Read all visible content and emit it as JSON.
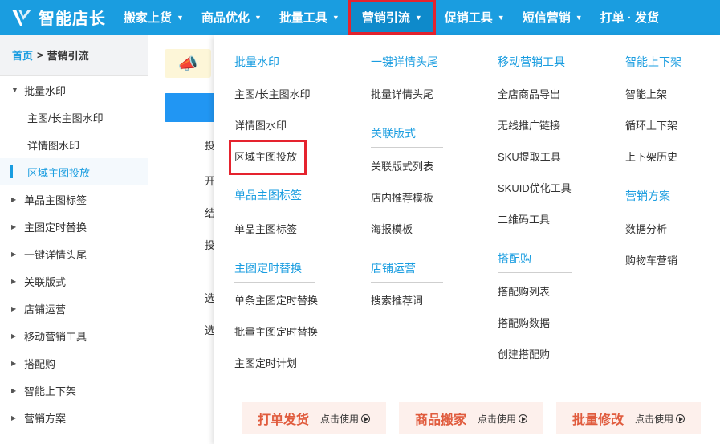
{
  "app": {
    "logo_text": "智能店长"
  },
  "nav": {
    "items": [
      {
        "label": "搬家上货"
      },
      {
        "label": "商品优化"
      },
      {
        "label": "批量工具"
      },
      {
        "label": "营销引流"
      },
      {
        "label": "促销工具"
      },
      {
        "label": "短信营销"
      },
      {
        "label": "打单 · 发货"
      }
    ]
  },
  "breadcrumb": {
    "home": "首页",
    "separator": ">",
    "current": "营销引流"
  },
  "sidebar": {
    "groups": [
      {
        "label": "批量水印",
        "children": [
          "主图/长主图水印",
          "详情图水印",
          "区域主图投放"
        ]
      },
      {
        "label": "单品主图标签"
      },
      {
        "label": "主图定时替换"
      },
      {
        "label": "一键详情头尾"
      },
      {
        "label": "关联版式"
      },
      {
        "label": "店铺运营"
      },
      {
        "label": "移动营销工具"
      },
      {
        "label": "搭配购"
      },
      {
        "label": "智能上下架"
      },
      {
        "label": "营销方案"
      }
    ]
  },
  "main_fragments": [
    "投",
    "开",
    "结",
    "投",
    "选",
    "选"
  ],
  "menu": {
    "col1": {
      "sections": [
        {
          "title": "批量水印",
          "links": [
            "主图/长主图水印",
            "详情图水印",
            "区域主图投放"
          ]
        },
        {
          "title": "单品主图标签",
          "links": [
            "单品主图标签"
          ]
        },
        {
          "title": "主图定时替换",
          "links": [
            "单条主图定时替换",
            "批量主图定时替换",
            "主图定时计划"
          ]
        }
      ]
    },
    "col2": {
      "sections": [
        {
          "title": "一键详情头尾",
          "links": [
            "批量详情头尾"
          ]
        },
        {
          "title": "关联版式",
          "links": [
            "关联版式列表",
            "店内推荐模板",
            "海报模板"
          ]
        },
        {
          "title": "店铺运营",
          "links": [
            "搜索推荐词"
          ]
        }
      ]
    },
    "col3": {
      "sections": [
        {
          "title": "移动营销工具",
          "links": [
            "全店商品导出",
            "无线推广链接",
            "SKU提取工具",
            "SKUID优化工具",
            "二维码工具"
          ]
        },
        {
          "title": "搭配购",
          "links": [
            "搭配购列表",
            "搭配购数据",
            "创建搭配购"
          ]
        }
      ]
    },
    "col4": {
      "sections": [
        {
          "title": "智能上下架",
          "links": [
            "智能上架",
            "循环上下架",
            "上下架历史"
          ]
        },
        {
          "title": "营销方案",
          "links": [
            "数据分析",
            "购物车营销"
          ]
        }
      ]
    }
  },
  "promos": [
    {
      "title": "打单发货",
      "action": "点击使用"
    },
    {
      "title": "商品搬家",
      "action": "点击使用"
    },
    {
      "title": "批量修改",
      "action": "点击使用"
    }
  ],
  "colors": {
    "brand": "#1a9de0",
    "highlight": "#e5232e",
    "promo_text": "#e05b3d"
  }
}
